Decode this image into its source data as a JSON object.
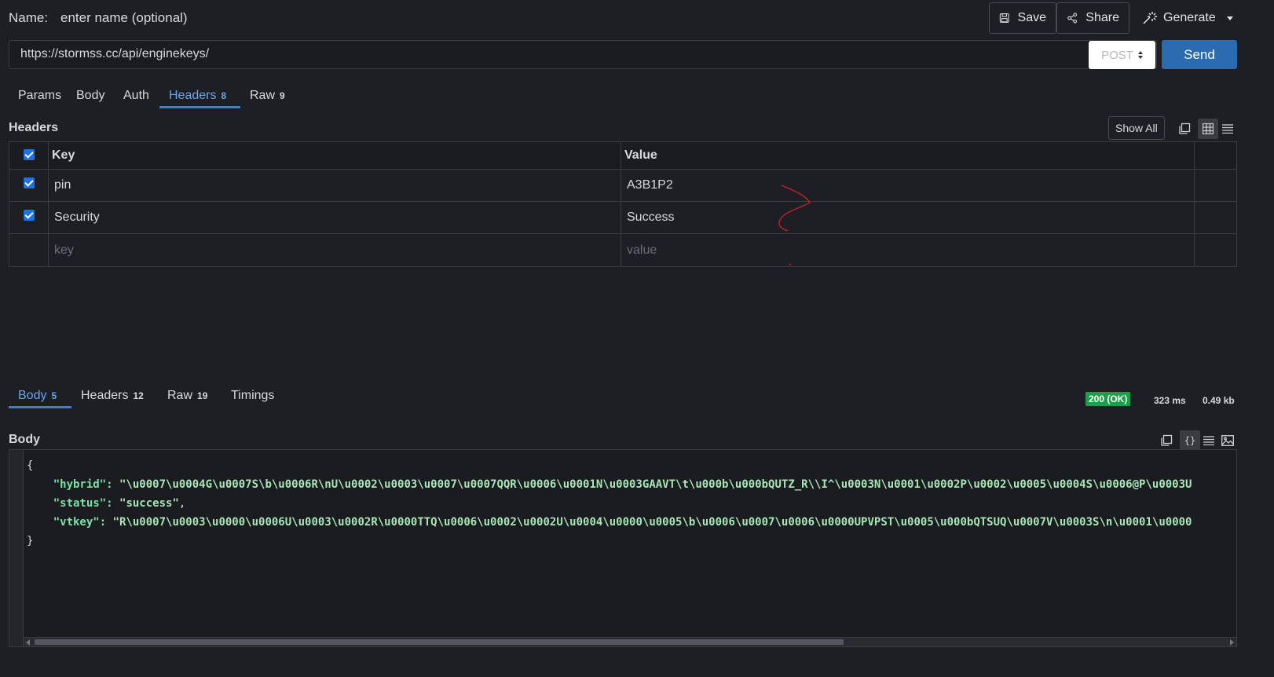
{
  "top": {
    "name_label": "Name:",
    "name_placeholder": "enter name (optional)",
    "save_label": "Save",
    "share_label": "Share",
    "generate_label": "Generate"
  },
  "request": {
    "url": "https://stormss.cc/api/enginekeys/",
    "method": "POST",
    "send_label": "Send",
    "tabs": [
      {
        "label": "Params",
        "count": ""
      },
      {
        "label": "Body",
        "count": ""
      },
      {
        "label": "Auth",
        "count": ""
      },
      {
        "label": "Headers",
        "count": "8"
      },
      {
        "label": "Raw",
        "count": "9"
      }
    ],
    "active_tab": "Headers",
    "headers_title": "Headers",
    "show_all_label": "Show All",
    "table": {
      "key_header": "Key",
      "value_header": "Value",
      "rows": [
        {
          "checked": true,
          "key": "pin",
          "value": "A3B1P2"
        },
        {
          "checked": true,
          "key": "Security",
          "value": "Success"
        }
      ],
      "key_placeholder": "key",
      "value_placeholder": "value"
    }
  },
  "response": {
    "tabs": [
      {
        "label": "Body",
        "count": "5"
      },
      {
        "label": "Headers",
        "count": "12"
      },
      {
        "label": "Raw",
        "count": "19"
      },
      {
        "label": "Timings",
        "count": ""
      }
    ],
    "active_tab": "Body",
    "status": "200 (OK)",
    "time": "323 ms",
    "size": "0.49 kb",
    "body_title": "Body",
    "body_lines": {
      "open": "{",
      "hybrid_key": "\"hybrid\"",
      "hybrid_value": "\"\\u0007\\u0004G\\u0007S\\b\\u0006R\\nU\\u0002\\u0003\\u0007\\u0007QQR\\u0006\\u0001N\\u0003GAAVT\\t\\u000b\\u000bQUTZ_R\\\\I^\\u0003N\\u0001\\u0002P\\u0002\\u0005\\u0004S\\u0006@P\\u0003U",
      "status_key": "\"status\"",
      "status_value": "\"success\"",
      "vtkey_key": "\"vtkey\"",
      "vtkey_value": "\"R\\u0007\\u0003\\u0000\\u0006U\\u0003\\u0002R\\u0000TTQ\\u0006\\u0002\\u0002U\\u0004\\u0000\\u0005\\b\\u0006\\u0007\\u0006\\u0000UPVPST\\u0005\\u000bQTSUQ\\u0007V\\u0003S\\n\\u0001\\u0000",
      "close": "}"
    }
  },
  "colors": {
    "accent": "#3e7dd6",
    "send_button": "#2b6cb0",
    "status_ok": "#1e9d4a",
    "background": "#1e1f24",
    "json_text": "#a8e6b8"
  }
}
